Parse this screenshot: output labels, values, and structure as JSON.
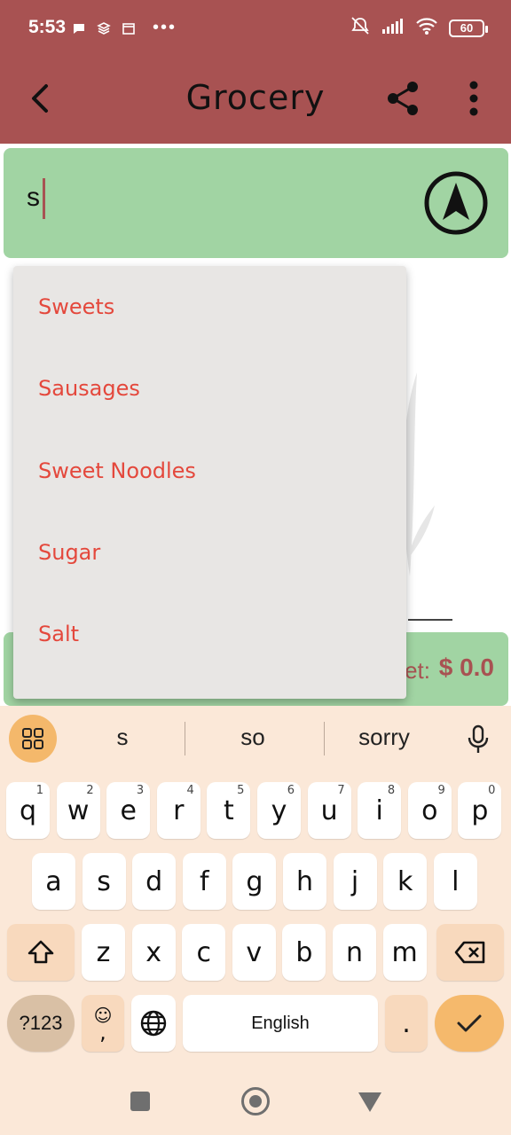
{
  "status_bar": {
    "time": "5:53",
    "dots": "•••",
    "battery": "60"
  },
  "app_bar": {
    "title": "Grocery",
    "background_color": "#a85252"
  },
  "search": {
    "value": "s",
    "field_color": "#a1d4a3"
  },
  "suggestions": [
    "Sweets",
    "Sausages",
    "Sweet Noodles",
    "Sugar",
    "Salt"
  ],
  "suggestion_text_color": "#e4483c",
  "budget": {
    "label_fragment": "et:",
    "value": "$ 0.0"
  },
  "keyboard": {
    "suggestions": [
      "s",
      "so",
      "sorry"
    ],
    "row1": [
      {
        "k": "q",
        "h": "1"
      },
      {
        "k": "w",
        "h": "2"
      },
      {
        "k": "e",
        "h": "3"
      },
      {
        "k": "r",
        "h": "4"
      },
      {
        "k": "t",
        "h": "5"
      },
      {
        "k": "y",
        "h": "6"
      },
      {
        "k": "u",
        "h": "7"
      },
      {
        "k": "i",
        "h": "8"
      },
      {
        "k": "o",
        "h": "9"
      },
      {
        "k": "p",
        "h": "0"
      }
    ],
    "row2": [
      "a",
      "s",
      "d",
      "f",
      "g",
      "h",
      "j",
      "k",
      "l"
    ],
    "row3": [
      "z",
      "x",
      "c",
      "v",
      "b",
      "n",
      "m"
    ],
    "symbols_label": "?123",
    "comma_label": ",",
    "emoji_glyph": "☺",
    "space_label": "English",
    "period_label": ".",
    "accent_color": "#f5b96c"
  }
}
